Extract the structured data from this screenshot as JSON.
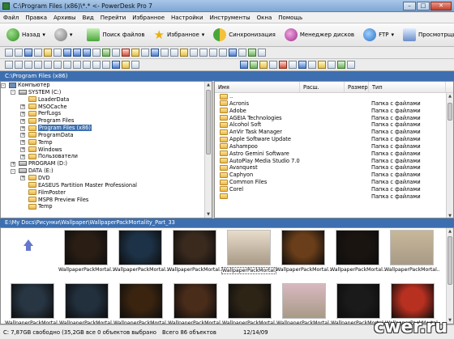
{
  "window": {
    "title": "C:\\Program Files (x86)\\*.* <- PowerDesk Pro 7"
  },
  "menu": [
    "Файл",
    "Правка",
    "Архивы",
    "Вид",
    "Перейти",
    "Избранное",
    "Настройки",
    "Инструменты",
    "Окна",
    "Помощь"
  ],
  "toolbar": {
    "back": "Назад",
    "find": "Поиск файлов",
    "favorites": "Избранное",
    "sync": "Синхронизация",
    "disk_manager": "Менеджер дисков",
    "ftp": "FTP",
    "viewer": "Просмотрщик"
  },
  "path_bar": "C:\\Program Files (x86)",
  "tree": [
    {
      "label": "Компьютер",
      "level": 0,
      "expander": "-",
      "icon": "computer-icon"
    },
    {
      "label": "SYSTEM (C:)",
      "level": 1,
      "expander": "-",
      "icon": "drive-icon"
    },
    {
      "label": "LoaderData",
      "level": 2,
      "expander": "",
      "icon": "folder-icon"
    },
    {
      "label": "MSOCache",
      "level": 2,
      "expander": "+",
      "icon": "folder-icon"
    },
    {
      "label": "PerfLogs",
      "level": 2,
      "expander": "+",
      "icon": "folder-icon"
    },
    {
      "label": "Program Files",
      "level": 2,
      "expander": "+",
      "icon": "folder-icon"
    },
    {
      "label": "Program Files (x86)",
      "level": 2,
      "expander": "+",
      "icon": "folder-icon",
      "selected": true
    },
    {
      "label": "ProgramData",
      "level": 2,
      "expander": "+",
      "icon": "folder-icon"
    },
    {
      "label": "Temp",
      "level": 2,
      "expander": "+",
      "icon": "folder-icon"
    },
    {
      "label": "Windows",
      "level": 2,
      "expander": "+",
      "icon": "folder-icon"
    },
    {
      "label": "Пользователи",
      "level": 2,
      "expander": "+",
      "icon": "folder-icon"
    },
    {
      "label": "PROGRAM (D:)",
      "level": 1,
      "expander": "+",
      "icon": "drive-icon"
    },
    {
      "label": "DATA (E:)",
      "level": 1,
      "expander": "-",
      "icon": "drive-icon"
    },
    {
      "label": "DVD",
      "level": 2,
      "expander": "+",
      "icon": "folder-icon"
    },
    {
      "label": "EASEUS Partition Master Professional",
      "level": 2,
      "expander": "",
      "icon": "folder-icon"
    },
    {
      "label": "FilmPoster",
      "level": 2,
      "expander": "",
      "icon": "folder-icon"
    },
    {
      "label": "MSP8 Preview Files",
      "level": 2,
      "expander": "",
      "icon": "folder-icon"
    },
    {
      "label": "Temp",
      "level": 2,
      "expander": "",
      "icon": "folder-icon"
    }
  ],
  "list": {
    "columns": [
      "Имя",
      "Расш.",
      "Размер",
      "Тип"
    ],
    "rows": [
      {
        "name": "..",
        "type": ""
      },
      {
        "name": "Acronis",
        "type": "Папка с файлами"
      },
      {
        "name": "Adobe",
        "type": "Папка с файлами"
      },
      {
        "name": "AGEIA Technologies",
        "type": "Папка с файлами"
      },
      {
        "name": "Alcohol Soft",
        "type": "Папка с файлами"
      },
      {
        "name": "AnVir Task Manager",
        "type": "Папка с файлами"
      },
      {
        "name": "Apple Software Update",
        "type": "Папка с файлами"
      },
      {
        "name": "Ashampoo",
        "type": "Папка с файлами"
      },
      {
        "name": "Astro Gemini Software",
        "type": "Папка с файлами"
      },
      {
        "name": "AutoPlay Media Studio 7.0 T...",
        "type": "Папка с файлами"
      },
      {
        "name": "Avanquest",
        "type": "Папка с файлами"
      },
      {
        "name": "Caphyon",
        "type": "Папка с файлами"
      },
      {
        "name": "Common Files",
        "type": "Папка с файлами"
      },
      {
        "name": "Corel",
        "type": "Папка с файлами"
      },
      {
        "name": "",
        "type": "Папка с файлами"
      }
    ]
  },
  "preview_path": "E:\\My Docs\\Рисунки\\Wallpaper\\WallpaperPackMortality_Part_33",
  "thumbnails": {
    "label": "WallpaperPackMortal...",
    "row1_colors": [
      "#2a1e14",
      "#1d3246",
      "#3a2a1e",
      "#e8dccb",
      "#6a3e1a",
      "#1a1410",
      "#c8b89a"
    ],
    "row2_colors": [
      "#283644",
      "#22303e",
      "#3a2410",
      "#4a2c1a",
      "#2e2416",
      "#d8b8c0",
      "#1a1a1a",
      "#b83020"
    ]
  },
  "status": {
    "free": "C: 7,87GB свободно (35,2GB все 0 объектов выбрано",
    "total": "Всего 86 объектов",
    "date": "12/14/09"
  },
  "watermark": "cwer.ru",
  "colors": {
    "accent": "#3d6fb0",
    "selection": "#3d6fb0"
  }
}
